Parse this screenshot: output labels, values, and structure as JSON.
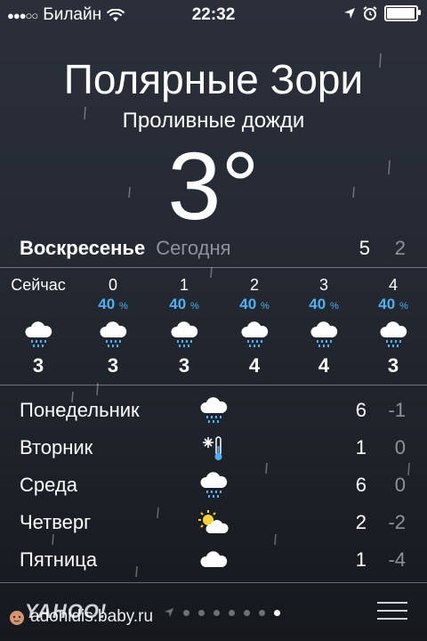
{
  "status_bar": {
    "carrier": "Билайн",
    "time": "22:32",
    "battery_level": 0.9
  },
  "location": {
    "city": "Полярные Зори",
    "condition": "Проливные дожди",
    "temperature": "3°"
  },
  "today": {
    "day": "Воскресенье",
    "label": "Сегодня",
    "high": "5",
    "low": "2"
  },
  "hourly": [
    {
      "time": "Сейчас",
      "precip": "",
      "precip_unit": "",
      "icon": "rain-cloud-icon",
      "temp": "3"
    },
    {
      "time": "0",
      "precip": "40",
      "precip_unit": "%",
      "icon": "rain-cloud-icon",
      "temp": "3"
    },
    {
      "time": "1",
      "precip": "40",
      "precip_unit": "%",
      "icon": "rain-cloud-icon",
      "temp": "3"
    },
    {
      "time": "2",
      "precip": "40",
      "precip_unit": "%",
      "icon": "rain-cloud-icon",
      "temp": "4"
    },
    {
      "time": "3",
      "precip": "40",
      "precip_unit": "%",
      "icon": "rain-cloud-icon",
      "temp": "4"
    },
    {
      "time": "4",
      "precip": "40",
      "precip_unit": "%",
      "icon": "rain-cloud-icon",
      "temp": "3"
    }
  ],
  "daily": [
    {
      "day": "Понедельник",
      "icon": "rain-cloud-icon",
      "high": "6",
      "low": "-1"
    },
    {
      "day": "Вторник",
      "icon": "snow-cold-icon",
      "high": "1",
      "low": "0"
    },
    {
      "day": "Среда",
      "icon": "rain-cloud-icon",
      "high": "6",
      "low": "0"
    },
    {
      "day": "Четверг",
      "icon": "partly-cloudy-icon",
      "high": "2",
      "low": "-2"
    },
    {
      "day": "Пятница",
      "icon": "cloud-icon",
      "high": "1",
      "low": "-4"
    }
  ],
  "bottom_bar": {
    "provider": "YAHOO!",
    "page_count": 8,
    "active_page": 8
  },
  "watermark": "adonidis.baby.ru",
  "colors": {
    "precip_blue": "#4fb0f0",
    "muted": "#8e929a"
  }
}
